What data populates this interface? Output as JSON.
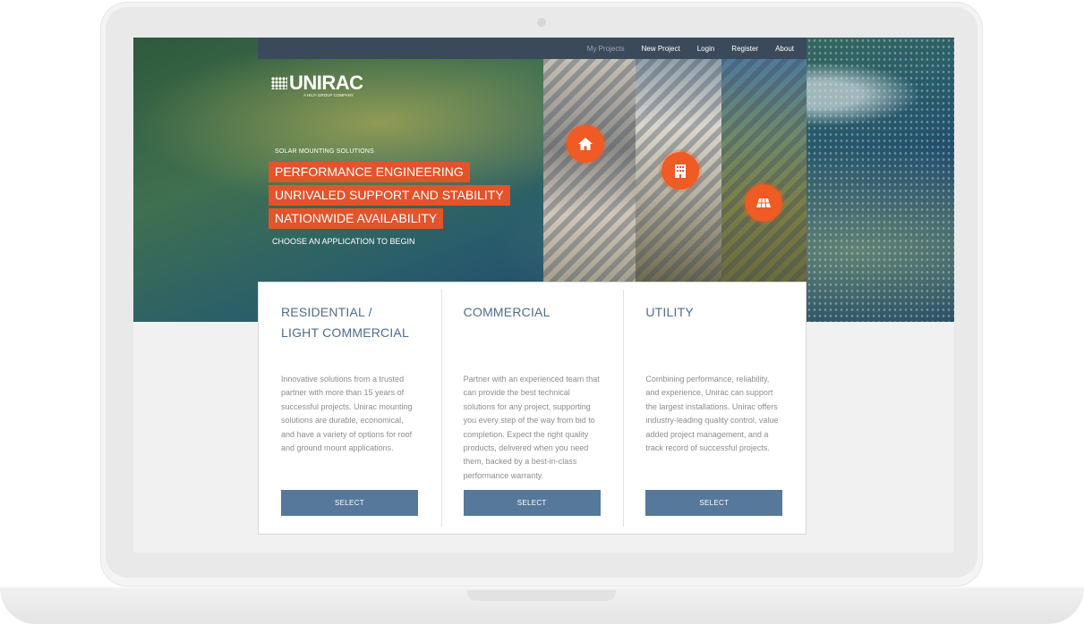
{
  "nav": {
    "items": [
      {
        "label": "My Projects",
        "muted": true
      },
      {
        "label": "New Project",
        "muted": false
      },
      {
        "label": "Login",
        "muted": false
      },
      {
        "label": "Register",
        "muted": false
      },
      {
        "label": "About",
        "muted": false
      }
    ]
  },
  "brand": {
    "name": "UNIRAC",
    "subtitle": "A HILTI GROUP COMPANY"
  },
  "hero": {
    "tagline": "SOLAR MOUNTING SOLUTIONS",
    "highlights": [
      "PERFORMANCE ENGINEERING",
      "UNRIVALED SUPPORT AND STABILITY",
      "NATIONWIDE AVAILABILITY"
    ],
    "cta": "CHOOSE AN APPLICATION TO BEGIN"
  },
  "applications": [
    {
      "icon": "house-icon",
      "title_line1": "RESIDENTIAL /",
      "title_line2": "LIGHT COMMERCIAL",
      "body": "Innovative solutions from a trusted partner with more than 15 years of successful projects. Unirac mounting solutions are durable, economical, and have a variety of options for roof and ground mount applications.",
      "button": "SELECT"
    },
    {
      "icon": "building-icon",
      "title_line1": "COMMERCIAL",
      "title_line2": "",
      "body": "Partner with an experienced team that can provide the best technical solutions for any project, supporting you every step of the way from bid to completion. Expect the right quality products, delivered when you need them, backed by a best-in-class performance warranty.",
      "button": "SELECT"
    },
    {
      "icon": "solar-panel-icon",
      "title_line1": "UTILITY",
      "title_line2": "",
      "body": "Combining performance, reliability, and experience, Unirac can support the largest installations. Unirac offers industry-leading quality control, value added project management, and a track record of successful projects.",
      "button": "SELECT"
    }
  ],
  "colors": {
    "accent": "#f05a24",
    "nav_bg": "#3b4a5b",
    "button": "#56789a",
    "title": "#4e6e8c"
  }
}
